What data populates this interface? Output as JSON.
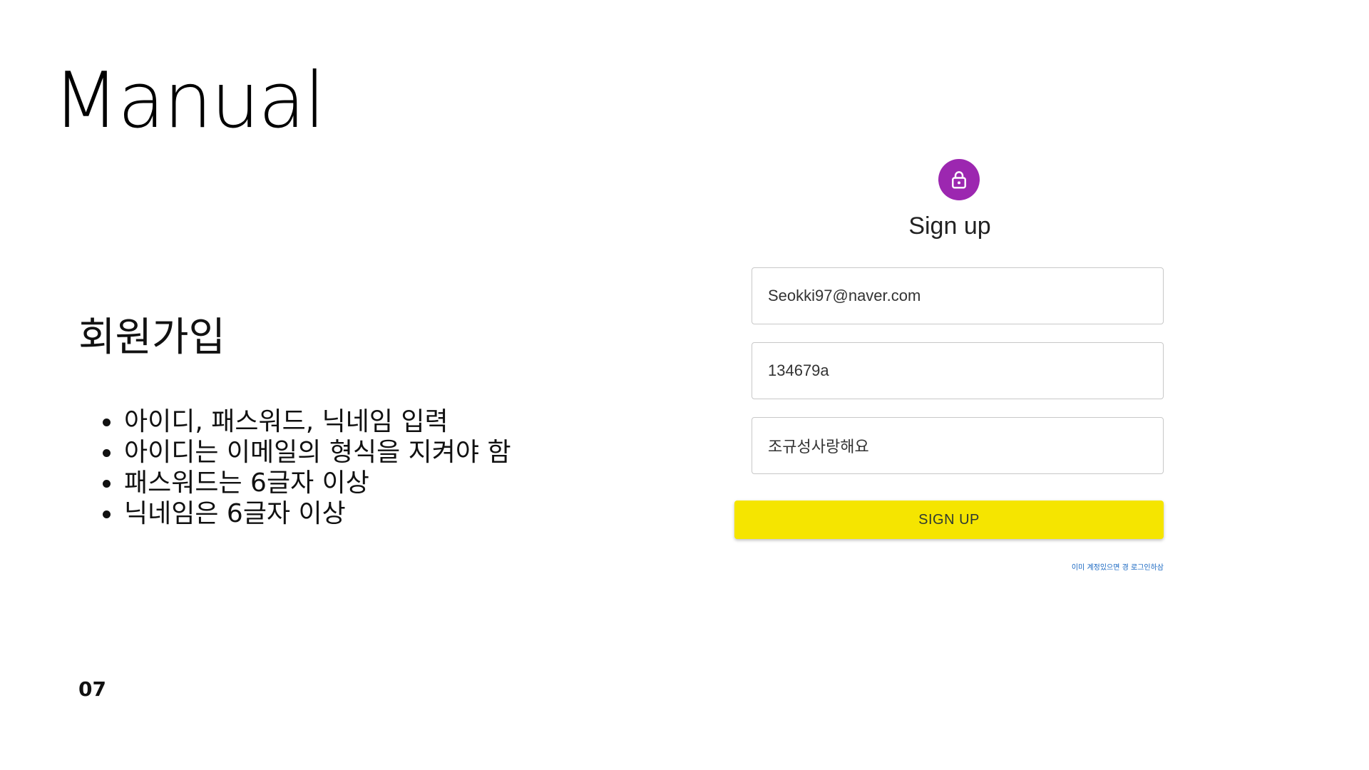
{
  "slide": {
    "title": "Manual",
    "section_heading": "회원가입",
    "bullets": [
      "아이디, 패스워드, 닉네임 입력",
      "아이디는 이메일의 형식을 지켜야 함",
      "패스워드는 6글자 이상",
      "닉네임은 6글자 이상"
    ],
    "page_number": "07"
  },
  "signup_form": {
    "icon": "lock-icon",
    "avatar_color": "#9c27b0",
    "title": "Sign up",
    "email_value": "Seokki97@naver.com",
    "password_value": "134679a",
    "nickname_value": "조규성사랑해요",
    "button_label": "SIGN UP",
    "button_color": "#f5e500",
    "login_link": "이미 계정있으면 경 로그인하삼"
  }
}
